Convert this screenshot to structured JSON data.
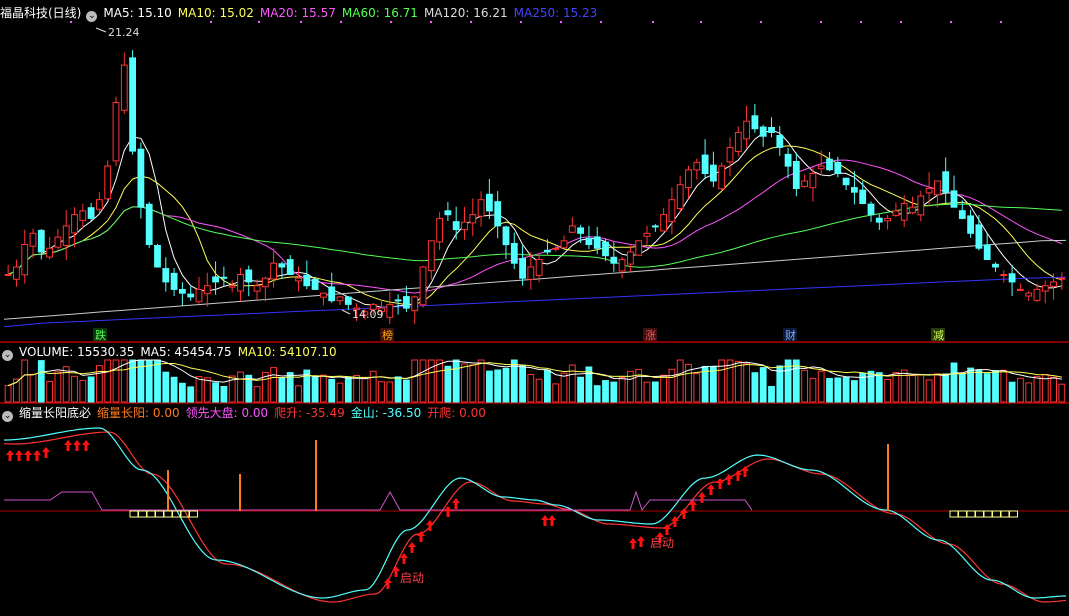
{
  "colors": {
    "up": "#ff3333",
    "down": "#54ffff",
    "ma5": "#ffffff",
    "ma10": "#ffff55",
    "ma20": "#ff55ff",
    "ma60": "#55ff55",
    "ma120": "#cccccc",
    "ma250": "#3333ff",
    "separator": "#b00000",
    "arrow": "#ff1010",
    "orange": "#ff7a1a"
  },
  "price_panel": {
    "stock_name": "福晶科技(日线)",
    "ma5": "MA5: 15.10",
    "ma10": "MA10: 15.02",
    "ma20": "MA20: 15.57",
    "ma60": "MA60: 16.71",
    "ma120": "MA120: 16.21",
    "ma250": "MA250: 15.23",
    "high_label": "21.24",
    "low_label": "14.09",
    "event_markers": [
      "跌",
      "榜",
      "涨",
      "财",
      "减"
    ]
  },
  "volume_panel": {
    "volume": "VOLUME: 15530.35",
    "ma5": "MA5: 45454.75",
    "ma10": "MA10: 54107.10"
  },
  "indicator_panel": {
    "name": "缩量长阳底必",
    "v1": "缩量长阳: 0.00",
    "v2": "领先大盘: 0.00",
    "v3": "爬升: -35.49",
    "v4": "金山: -36.50",
    "v5": "开爬: 0.00",
    "signal_1": "启动",
    "signal_2": "启动"
  },
  "chart_data": {
    "type": "candlestick",
    "price_range": [
      13.6,
      22.0
    ],
    "high": 21.24,
    "low": 14.09,
    "closes": [
      15.3,
      15.5,
      16.1,
      16.4,
      15.9,
      16.0,
      16.3,
      16.6,
      16.9,
      17.0,
      16.8,
      17.3,
      18.2,
      19.9,
      20.9,
      18.6,
      17.1,
      16.1,
      15.5,
      15.1,
      14.9,
      14.8,
      14.7,
      14.9,
      15.0,
      15.1,
      15.2,
      15.0,
      15.3,
      15.1,
      15.0,
      15.2,
      15.6,
      15.5,
      15.3,
      15.2,
      15.0,
      14.9,
      14.8,
      14.6,
      14.7,
      14.5,
      14.4,
      14.3,
      14.5,
      14.4,
      14.5,
      14.6,
      14.4,
      14.7,
      15.5,
      16.2,
      16.8,
      16.9,
      16.5,
      16.7,
      16.9,
      17.3,
      17.0,
      16.6,
      16.1,
      15.6,
      15.2,
      15.5,
      15.7,
      15.9,
      16.0,
      16.2,
      16.6,
      16.4,
      16.1,
      16.0,
      15.8,
      15.6,
      15.7,
      15.9,
      16.2,
      16.4,
      16.6,
      16.9,
      17.3,
      17.7,
      18.1,
      18.3,
      18.0,
      17.8,
      18.2,
      18.7,
      19.1,
      19.4,
      19.2,
      19.0,
      19.1,
      18.7,
      18.2,
      17.6,
      17.8,
      18.0,
      18.2,
      18.1,
      18.0,
      17.7,
      17.5,
      17.2,
      16.9,
      16.7,
      16.8,
      17.0,
      17.2,
      17.1,
      17.4,
      17.6,
      17.8,
      17.5,
      17.1,
      16.8,
      16.4,
      16.0,
      15.7,
      15.5,
      15.3,
      15.1,
      14.9,
      14.8,
      14.9,
      15.0,
      15.1,
      15.2
    ],
    "ma120": [
      14.1,
      14.15,
      14.2,
      14.25,
      14.3,
      14.35,
      14.4,
      14.45,
      14.5,
      14.55,
      14.6,
      14.65,
      14.7,
      14.75,
      14.8,
      14.85,
      14.9,
      14.95,
      15.0,
      15.05,
      15.1,
      15.15,
      15.2,
      15.25,
      15.3,
      15.35,
      15.4,
      15.45,
      15.5,
      15.55,
      15.6,
      15.65,
      15.7,
      15.75,
      15.8,
      15.85,
      15.9,
      15.95,
      16.0,
      16.05,
      16.1,
      16.15,
      16.2,
      16.21
    ],
    "ma250": [
      13.9,
      14.0,
      14.05,
      14.1,
      14.15,
      14.2,
      14.25,
      14.3,
      14.35,
      14.4,
      14.45,
      14.5,
      14.55,
      14.6,
      14.65,
      14.7,
      14.75,
      14.8,
      14.85,
      14.9,
      14.95,
      15.0,
      15.05,
      15.1,
      15.15,
      15.2,
      15.23
    ]
  }
}
